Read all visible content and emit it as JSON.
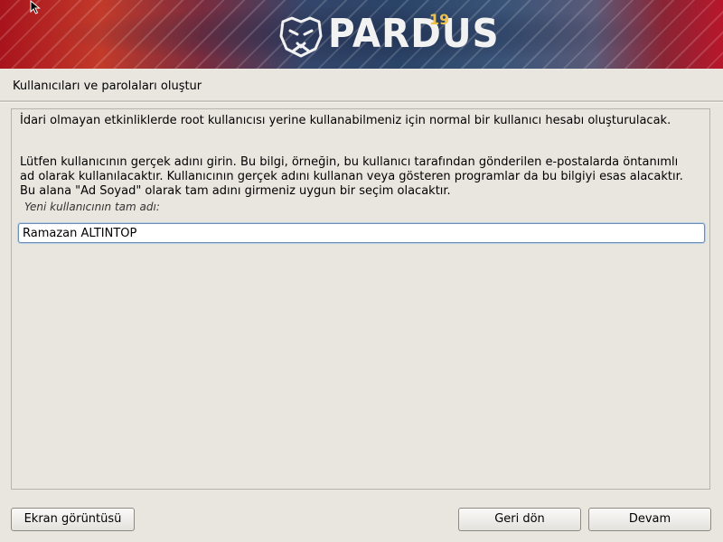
{
  "header": {
    "brand": "PARDUS",
    "version": "19",
    "colors": {
      "wordmark": "#f2f2f2",
      "version": "#f0c24a"
    }
  },
  "page": {
    "title": "Kullanıcıları ve parolaları oluştur",
    "paragraph1": "İdari olmayan etkinliklerde root kullanıcısı yerine kullanabilmeniz için normal bir kullanıcı hesabı oluşturulacak.",
    "paragraph2": "Lütfen kullanıcının gerçek adını girin. Bu bilgi, örneğin, bu kullanıcı tarafından gönderilen e-postalarda öntanımlı ad olarak kullanılacaktır. Kullanıcının gerçek adını kullanan veya gösteren programlar da bu bilgiyi esas alacaktır. Bu alana \"Ad Soyad\" olarak tam adını girmeniz uygun bir seçim olacaktır.",
    "field_label": "Yeni kullanıcının tam adı:",
    "field_value": "Ramazan ALTINTOP"
  },
  "buttons": {
    "screenshot": "Ekran görüntüsü",
    "back": "Geri dön",
    "continue": "Devam"
  },
  "icons": {
    "logo": "cat-head-icon",
    "cursor": "mouse-pointer-icon"
  }
}
